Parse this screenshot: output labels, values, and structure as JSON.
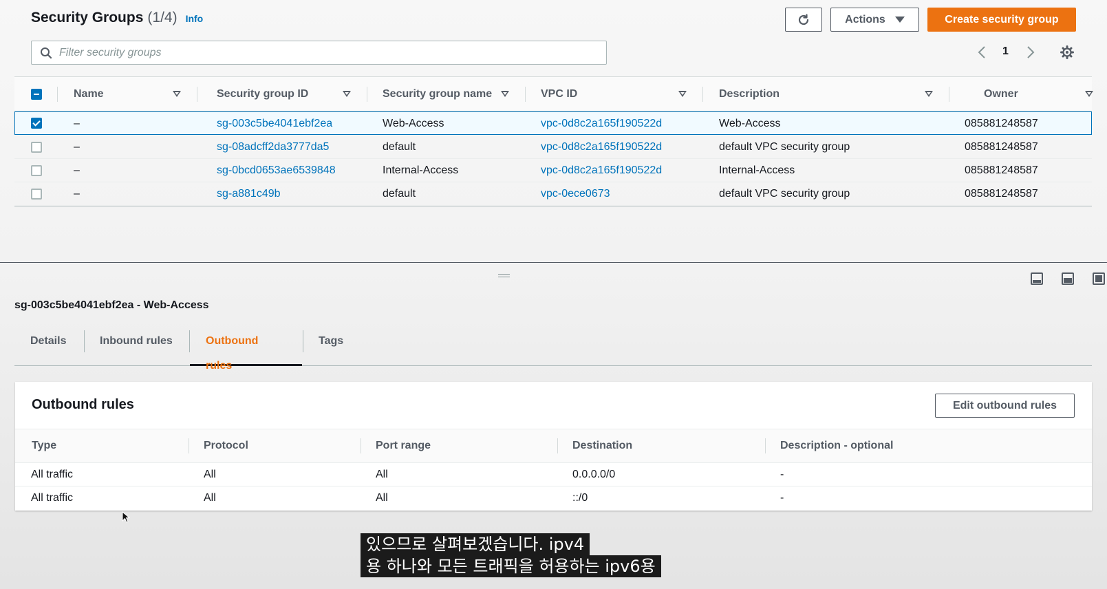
{
  "header": {
    "title": "Security Groups",
    "count": "(1/4)",
    "info": "Info",
    "actions_label": "Actions",
    "create_label": "Create security group"
  },
  "search": {
    "placeholder": "Filter security groups"
  },
  "pagination": {
    "page": "1"
  },
  "groups_table": {
    "columns": [
      "Name",
      "Security group ID",
      "Security group name",
      "VPC ID",
      "Description",
      "Owner"
    ],
    "rows": [
      {
        "selected": true,
        "name": "–",
        "sg_id": "sg-003c5be4041ebf2ea",
        "sg_name": "Web-Access",
        "vpc": "vpc-0d8c2a165f190522d",
        "description": "Web-Access",
        "owner": "085881248587"
      },
      {
        "selected": false,
        "name": "–",
        "sg_id": "sg-08adcff2da3777da5",
        "sg_name": "default",
        "vpc": "vpc-0d8c2a165f190522d",
        "description": "default VPC security group",
        "owner": "085881248587"
      },
      {
        "selected": false,
        "name": "–",
        "sg_id": "sg-0bcd0653ae6539848",
        "sg_name": "Internal-Access",
        "vpc": "vpc-0d8c2a165f190522d",
        "description": "Internal-Access",
        "owner": "085881248587"
      },
      {
        "selected": false,
        "name": "–",
        "sg_id": "sg-a881c49b",
        "sg_name": "default",
        "vpc": "vpc-0ece0673",
        "description": "default VPC security group",
        "owner": "085881248587"
      }
    ]
  },
  "detail": {
    "title": "sg-003c5be4041ebf2ea - Web-Access",
    "tabs": [
      "Details",
      "Inbound rules",
      "Outbound rules",
      "Tags"
    ],
    "active_tab": "Outbound rules"
  },
  "outbound": {
    "title": "Outbound rules",
    "edit_label": "Edit outbound rules",
    "columns": [
      "Type",
      "Protocol",
      "Port range",
      "Destination",
      "Description - optional"
    ],
    "rows": [
      {
        "type": "All traffic",
        "protocol": "All",
        "port_range": "All",
        "destination": "0.0.0.0/0",
        "description": "-"
      },
      {
        "type": "All traffic",
        "protocol": "All",
        "port_range": "All",
        "destination": "::/0",
        "description": "-"
      }
    ]
  },
  "subtitles": {
    "line1": "있으므로 살펴보겠습니다. ipv4",
    "line2": "용 하나와 모든 트래픽을 허용하는 ipv6용"
  },
  "colors": {
    "accent": "#ec7211",
    "link": "#0073bb",
    "selection_border": "#0073bb"
  },
  "icons": [
    "search-icon",
    "refresh-icon",
    "caret-down-icon",
    "chevron-left-icon",
    "chevron-right-icon",
    "gear-icon",
    "panel-layout-icon",
    "mouse-cursor-icon"
  ]
}
